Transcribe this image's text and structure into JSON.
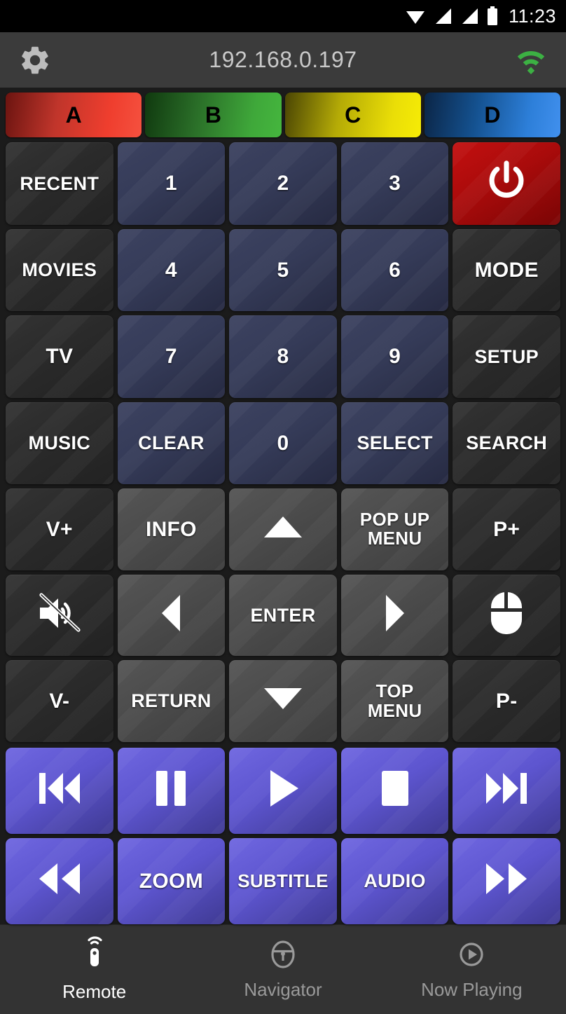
{
  "statusbar": {
    "time": "11:23",
    "icons": [
      "wifi-icon",
      "signal-icon",
      "signal-icon",
      "battery-icon"
    ]
  },
  "header": {
    "gear_icon": "gear-icon",
    "ip_address": "192.168.0.197",
    "wifi_icon": "wifi-connected-icon",
    "wifi_color": "#3cb043",
    "background": "#3b3b3b"
  },
  "color_buttons": [
    {
      "label": "A",
      "color": "#ef3e2e",
      "name": "color-button-a"
    },
    {
      "label": "B",
      "color": "#3fa83a",
      "name": "color-button-b"
    },
    {
      "label": "C",
      "color": "#f6ec06",
      "name": "color-button-c"
    },
    {
      "label": "D",
      "color": "#2d7fd9",
      "name": "color-button-d"
    }
  ],
  "numpad": [
    {
      "label": "RECENT",
      "style": "k-dark",
      "name": "recent-button"
    },
    {
      "label": "1",
      "style": "k-navy",
      "name": "digit-1-button"
    },
    {
      "label": "2",
      "style": "k-navy",
      "name": "digit-2-button"
    },
    {
      "label": "3",
      "style": "k-navy",
      "name": "digit-3-button"
    },
    {
      "label": "",
      "style": "k-red",
      "name": "power-button",
      "icon": "power-icon"
    },
    {
      "label": "MOVIES",
      "style": "k-dark",
      "name": "movies-button"
    },
    {
      "label": "4",
      "style": "k-navy",
      "name": "digit-4-button"
    },
    {
      "label": "5",
      "style": "k-navy",
      "name": "digit-5-button"
    },
    {
      "label": "6",
      "style": "k-navy",
      "name": "digit-6-button"
    },
    {
      "label": "MODE",
      "style": "k-dark",
      "name": "mode-button"
    },
    {
      "label": "TV",
      "style": "k-dark",
      "name": "tv-button"
    },
    {
      "label": "7",
      "style": "k-navy",
      "name": "digit-7-button"
    },
    {
      "label": "8",
      "style": "k-navy",
      "name": "digit-8-button"
    },
    {
      "label": "9",
      "style": "k-navy",
      "name": "digit-9-button"
    },
    {
      "label": "SETUP",
      "style": "k-dark",
      "name": "setup-button"
    },
    {
      "label": "MUSIC",
      "style": "k-dark",
      "name": "music-button"
    },
    {
      "label": "CLEAR",
      "style": "k-navy",
      "name": "clear-button"
    },
    {
      "label": "0",
      "style": "k-navy",
      "name": "digit-0-button"
    },
    {
      "label": "SELECT",
      "style": "k-navy",
      "name": "select-button"
    },
    {
      "label": "SEARCH",
      "style": "k-dark",
      "name": "search-button"
    }
  ],
  "navpad": [
    {
      "label": "V+",
      "style": "k-dark",
      "name": "volume-up-button"
    },
    {
      "label": "INFO",
      "style": "k-gray",
      "name": "info-button"
    },
    {
      "label": "",
      "style": "k-gray",
      "name": "dpad-up-button",
      "icon": "arrow-up-icon"
    },
    {
      "label": "POP UP\nMENU",
      "style": "k-gray",
      "name": "popup-menu-button"
    },
    {
      "label": "P+",
      "style": "k-dark",
      "name": "page-up-button"
    },
    {
      "label": "",
      "style": "k-dark",
      "name": "mute-button",
      "icon": "mute-icon"
    },
    {
      "label": "",
      "style": "k-gray",
      "name": "dpad-left-button",
      "icon": "arrow-left-icon"
    },
    {
      "label": "ENTER",
      "style": "k-gray",
      "name": "enter-button"
    },
    {
      "label": "",
      "style": "k-gray",
      "name": "dpad-right-button",
      "icon": "arrow-right-icon"
    },
    {
      "label": "",
      "style": "k-dark",
      "name": "mouse-button",
      "icon": "mouse-icon"
    },
    {
      "label": "V-",
      "style": "k-dark",
      "name": "volume-down-button"
    },
    {
      "label": "RETURN",
      "style": "k-gray",
      "name": "return-button"
    },
    {
      "label": "",
      "style": "k-gray",
      "name": "dpad-down-button",
      "icon": "arrow-down-icon"
    },
    {
      "label": "TOP\nMENU",
      "style": "k-gray",
      "name": "top-menu-button"
    },
    {
      "label": "P-",
      "style": "k-dark",
      "name": "page-down-button"
    }
  ],
  "mediapad": [
    {
      "label": "",
      "style": "k-purple",
      "name": "skip-previous-button",
      "icon": "skip-previous-icon"
    },
    {
      "label": "",
      "style": "k-purple",
      "name": "pause-button",
      "icon": "pause-icon"
    },
    {
      "label": "",
      "style": "k-purple",
      "name": "play-button",
      "icon": "play-icon"
    },
    {
      "label": "",
      "style": "k-purple",
      "name": "stop-button",
      "icon": "stop-icon"
    },
    {
      "label": "",
      "style": "k-purple",
      "name": "skip-next-button",
      "icon": "skip-next-icon"
    },
    {
      "label": "",
      "style": "k-purple",
      "name": "rewind-button",
      "icon": "rewind-icon"
    },
    {
      "label": "ZOOM",
      "style": "k-purple",
      "name": "zoom-button"
    },
    {
      "label": "SUBTITLE",
      "style": "k-purple",
      "name": "subtitle-button"
    },
    {
      "label": "AUDIO",
      "style": "k-purple",
      "name": "audio-button"
    },
    {
      "label": "",
      "style": "k-purple",
      "name": "fast-forward-button",
      "icon": "fast-forward-icon"
    }
  ],
  "bottom_nav": {
    "items": [
      {
        "label": "Remote",
        "icon": "remote-icon",
        "active": true
      },
      {
        "label": "Navigator",
        "icon": "steering-wheel-icon",
        "active": false
      },
      {
        "label": "Now Playing",
        "icon": "play-circle-icon",
        "active": false
      }
    ]
  }
}
